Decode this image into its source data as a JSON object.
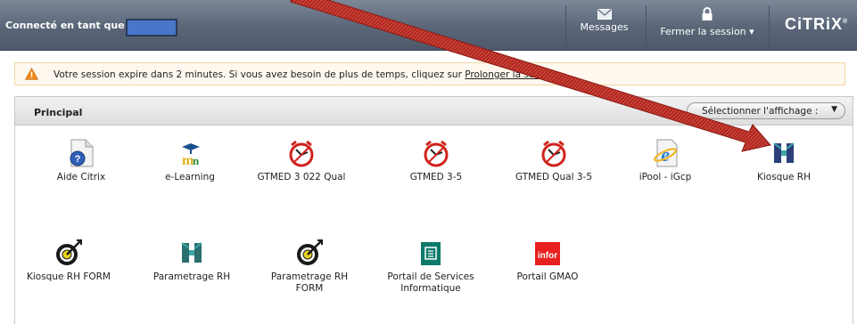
{
  "header": {
    "logged_in_as": "Connecté en tant que",
    "messages_label": "Messages",
    "logout_label": "Fermer la session",
    "brand": "CiTRiX",
    "brand_mark": "®"
  },
  "alert": {
    "text_before": "Votre session expire dans 2 minutes. Si vous avez besoin de plus de temps, cliquez sur ",
    "link_text": "Prolonger la session",
    "text_after": "."
  },
  "panel": {
    "title": "Principal",
    "view_selector_label": "Sélectionner l'affichage :"
  },
  "apps": [
    {
      "label": "Aide Citrix",
      "icon": "help-document-icon"
    },
    {
      "label": "e-Learning",
      "icon": "e-learning-icon"
    },
    {
      "label": "GTMED 3 022 Qual",
      "icon": "gtmed-clock-icon"
    },
    {
      "label": "GTMED 3-5",
      "icon": "gtmed-clock-icon"
    },
    {
      "label": "GTMED Qual 3-5",
      "icon": "gtmed-clock-icon"
    },
    {
      "label": "iPool - iGcp",
      "icon": "internet-explorer-icon"
    },
    {
      "label": "Kiosque RH",
      "icon": "hr-building-icon"
    },
    {
      "label": "Kiosque RH FORM",
      "icon": "target-arrow-icon"
    },
    {
      "label": "Parametrage RH",
      "icon": "hr-building-icon"
    },
    {
      "label": "Parametrage RH FORM",
      "icon": "target-arrow-icon"
    },
    {
      "label": "Portail de Services Informatique",
      "icon": "portal-book-icon"
    },
    {
      "label": "Portail GMAO",
      "icon": "infor-logo-icon"
    }
  ],
  "infor_logo_text": "infor",
  "colors": {
    "topbar": "#5a6678",
    "alert_bg": "#fff8ee",
    "annotation_arrow": "#b3261e",
    "user_box": "#4a76c9"
  }
}
